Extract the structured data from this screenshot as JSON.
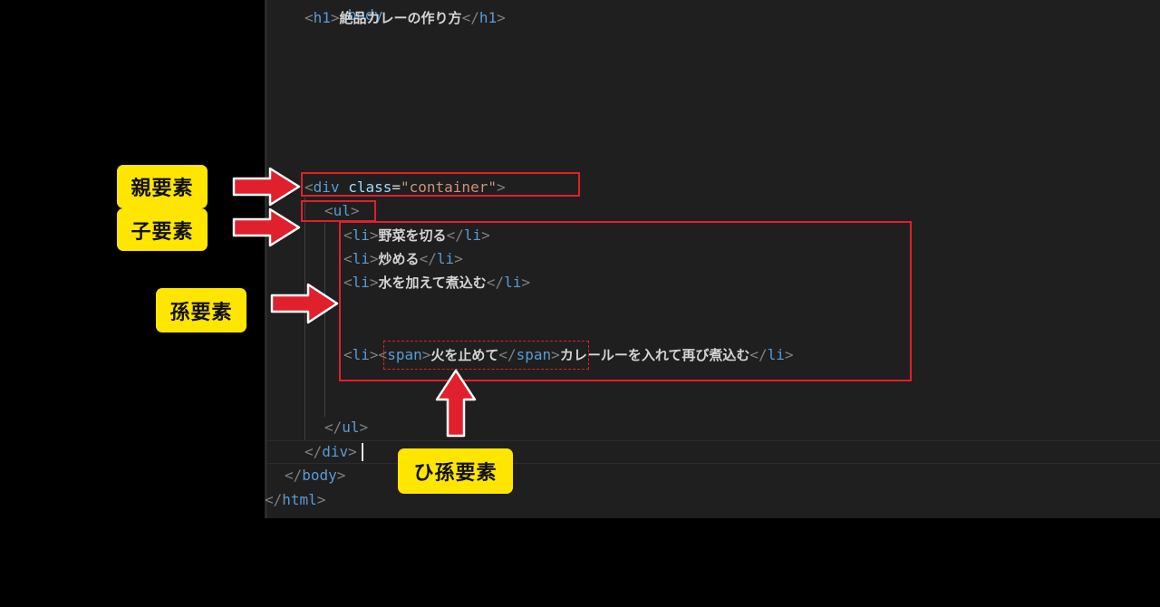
{
  "code": {
    "line_body_cut": "body",
    "h1": {
      "open": "h1",
      "text": "絶品カレーの作り方",
      "close": "h1"
    },
    "div_open": {
      "tag": "div",
      "attr": "class",
      "eq": "=",
      "value": "\"container\""
    },
    "ul_open": "ul",
    "li_items": [
      {
        "tag": "li",
        "text": "野菜を切る"
      },
      {
        "tag": "li",
        "text": "炒める"
      },
      {
        "tag": "li",
        "text": "水を加えて煮込む"
      }
    ],
    "li_span": {
      "li_tag": "li",
      "span_tag": "span",
      "span_text": "火を止めて",
      "after_text": "カレールーを入れて再び煮込む"
    },
    "ul_close": "ul",
    "div_close": "div",
    "body_close": "body",
    "html_close": "html"
  },
  "callouts": {
    "parent": "親要素",
    "child": "子要素",
    "grandchild": "孫要素",
    "great_grandchild": "ひ孫要素"
  },
  "colors": {
    "editor_bg": "#1f1f1f",
    "callout_bg": "#ffe600",
    "highlight_red": "#e0202c",
    "tag_blue": "#569cd6",
    "attr_lightblue": "#9cdcfe",
    "string_orange": "#ce9178"
  },
  "icons": {
    "arrow": "red-arrow-icon"
  }
}
